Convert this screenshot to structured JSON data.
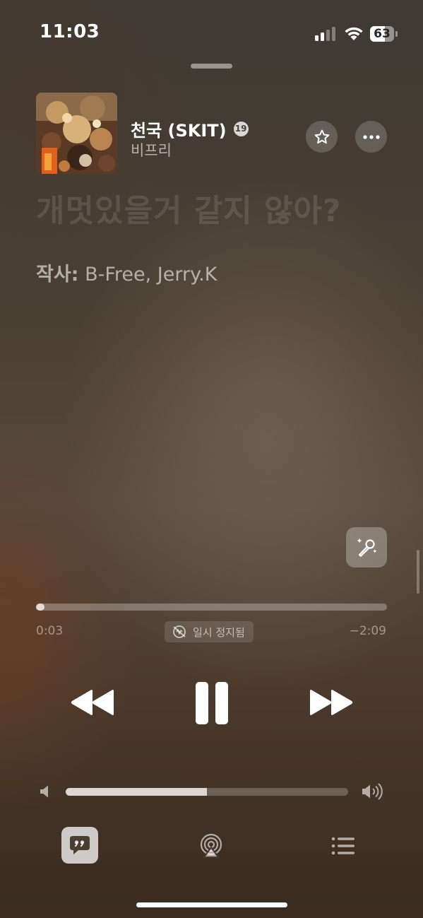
{
  "status_bar": {
    "time": "11:03",
    "battery_percent": "63",
    "battery_level": 0.63,
    "signal_bars_filled": 2,
    "signal_bars_total": 4
  },
  "now_playing": {
    "title": "천국 (SKIT)",
    "explicit_badge": "19",
    "artist": "비프리",
    "artwork_name": "album-artwork"
  },
  "lyrics": {
    "faded_line": "개멋있을거 같지 않아?",
    "credits_label": "작사:",
    "credits_value": " B-Free, Jerry.K"
  },
  "playback": {
    "elapsed": "0:03",
    "remaining": "−2:09",
    "progress_fraction": 0.025,
    "status_badge": "일시 정지됨"
  },
  "volume": {
    "level_fraction": 0.5
  },
  "icons": {
    "favorite": "star-icon",
    "more": "ellipsis-icon",
    "sing": "microphone-sparkle-icon",
    "rewind": "rewind-icon",
    "pause": "pause-icon",
    "forward": "fast-forward-icon",
    "volume_low": "speaker-low-icon",
    "volume_high": "speaker-high-icon",
    "lyrics": "lyrics-quote-icon",
    "airplay": "airplay-icon",
    "queue": "queue-list-icon"
  },
  "colors": {
    "background_top": "#3f3a35",
    "background_mid": "#574a3d",
    "background_bottom": "#3a2b1f",
    "foreground": "#ffffff"
  }
}
